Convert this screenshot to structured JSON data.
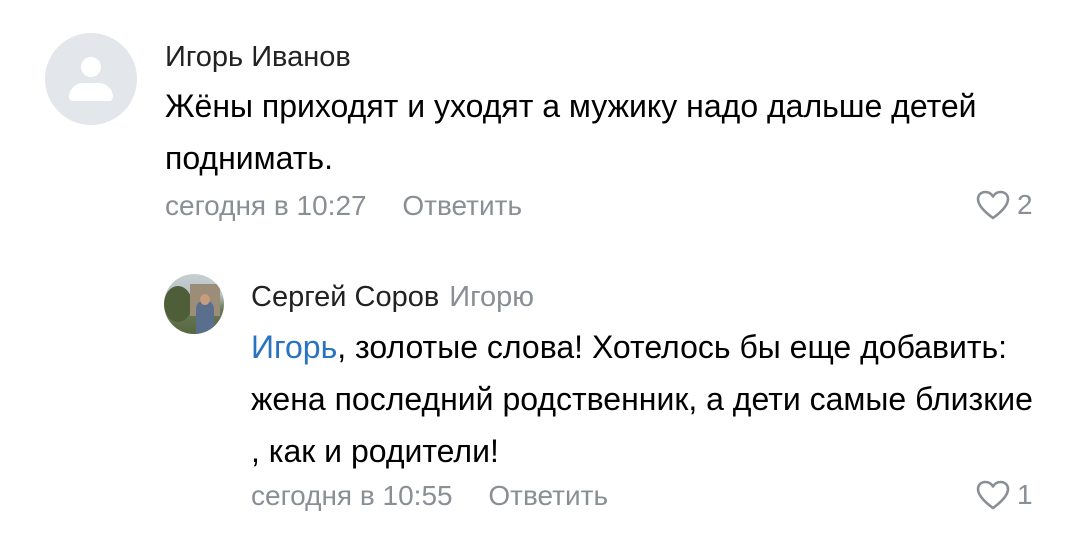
{
  "comments": [
    {
      "author": "Игорь Иванов",
      "text": "Жёны приходят и уходят а мужику надо дальше детей поднимать.",
      "time": "сегодня в 10:27",
      "reply_label": "Ответить",
      "likes": "2"
    },
    {
      "author": "Сергей Соров",
      "reply_to": "Игорю",
      "mention": "Игорь",
      "text": ", золотые слова! Хотелось бы еще добавить: жена последний родственник, а дети самые близкие , как и родители!",
      "time": "сегодня в 10:55",
      "reply_label": "Ответить",
      "likes": "1"
    }
  ],
  "colors": {
    "mention": "#2a73c0",
    "meta": "#8a8f96",
    "avatar_placeholder": "#e3e6ea"
  }
}
